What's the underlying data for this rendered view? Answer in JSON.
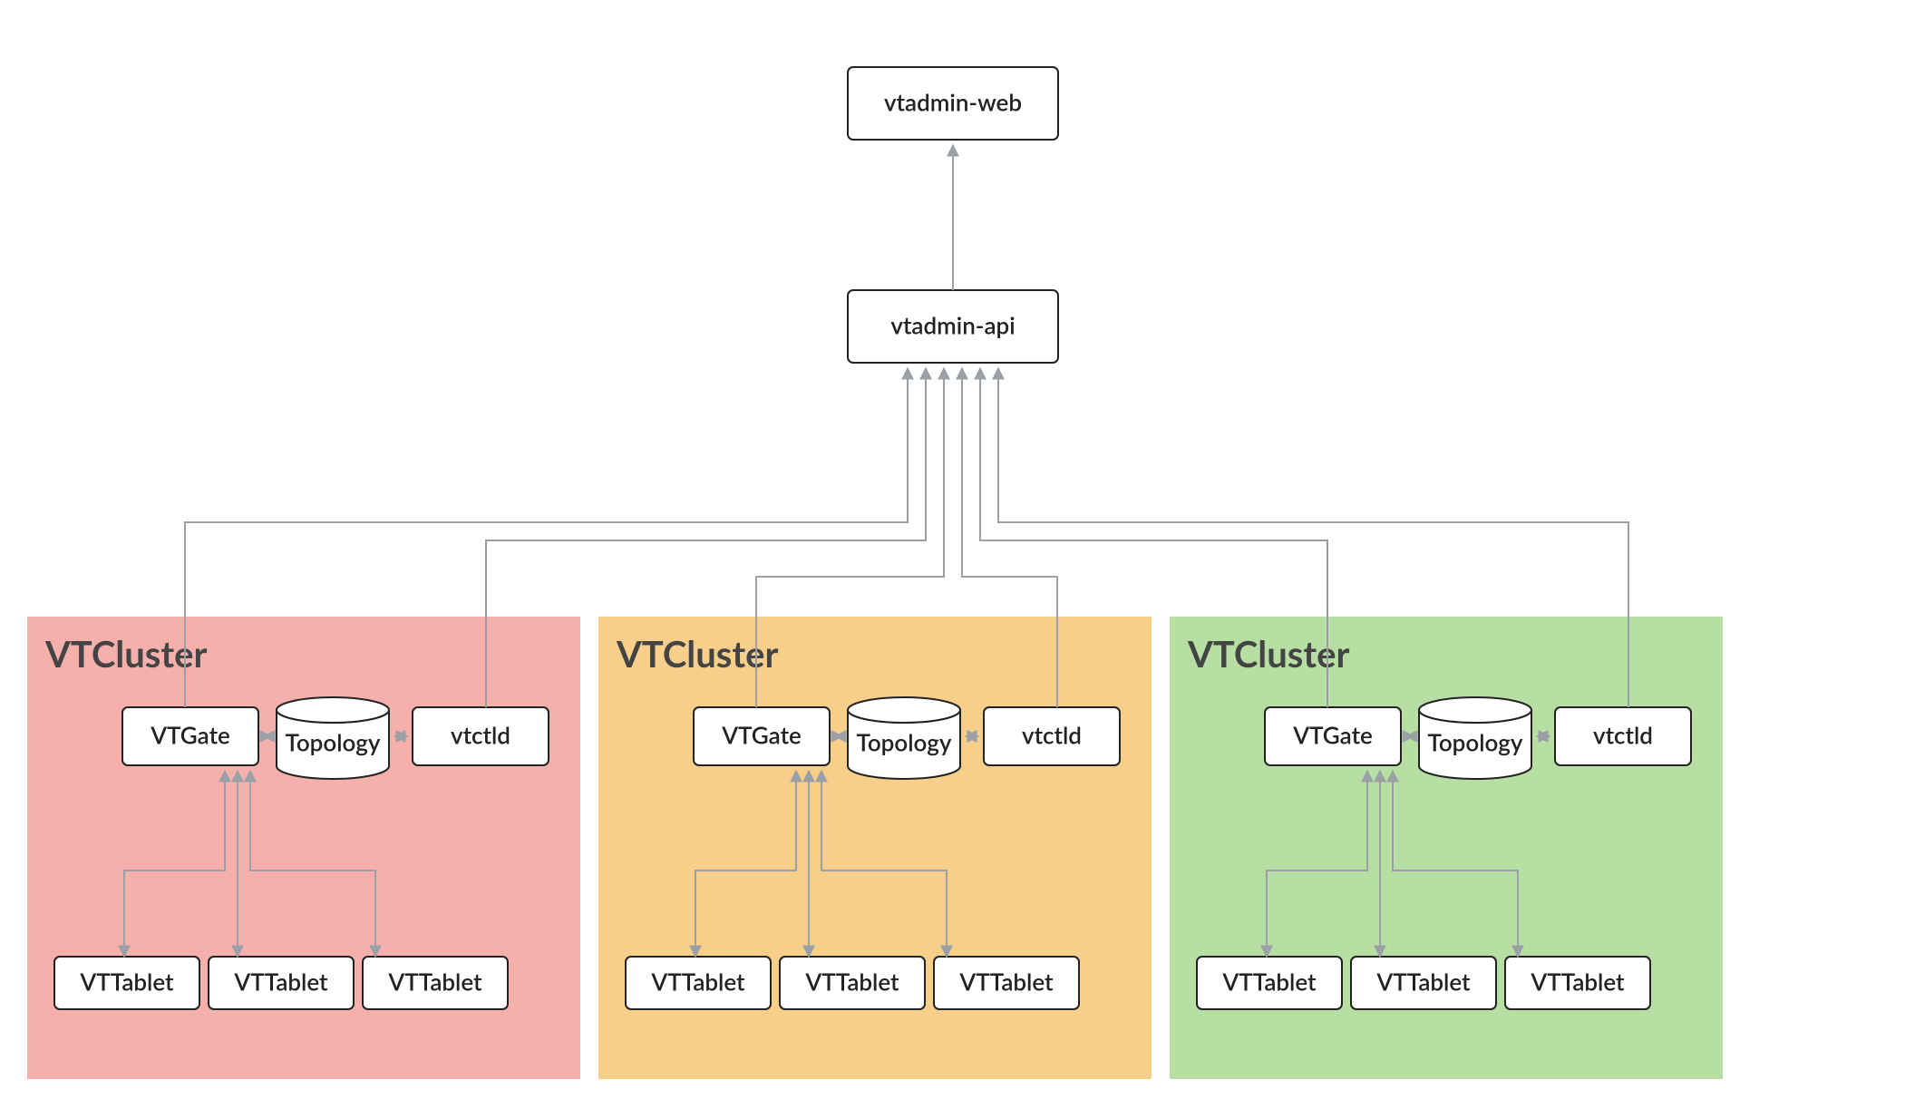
{
  "colors": {
    "cluster_red": "#f5b0ab",
    "cluster_amber": "#f7cf8a",
    "cluster_green": "#b7dfa3",
    "edge": "#9aa0a6",
    "node_stroke": "#222222",
    "node_fill": "#ffffff"
  },
  "top": {
    "web_label": "vtadmin-web",
    "api_label": "vtadmin-api"
  },
  "clusters": [
    {
      "title": "VTCluster",
      "color_key": "cluster_red",
      "vtgate_label": "VTGate",
      "topology_label": "Topology",
      "vtctld_label": "vtctld",
      "tablets": [
        "VTTablet",
        "VTTablet",
        "VTTablet"
      ]
    },
    {
      "title": "VTCluster",
      "color_key": "cluster_amber",
      "vtgate_label": "VTGate",
      "topology_label": "Topology",
      "vtctld_label": "vtctld",
      "tablets": [
        "VTTablet",
        "VTTablet",
        "VTTablet"
      ]
    },
    {
      "title": "VTCluster",
      "color_key": "cluster_green",
      "vtgate_label": "VTGate",
      "topology_label": "Topology",
      "vtctld_label": "vtctld",
      "tablets": [
        "VTTablet",
        "VTTablet",
        "VTTablet"
      ]
    }
  ]
}
